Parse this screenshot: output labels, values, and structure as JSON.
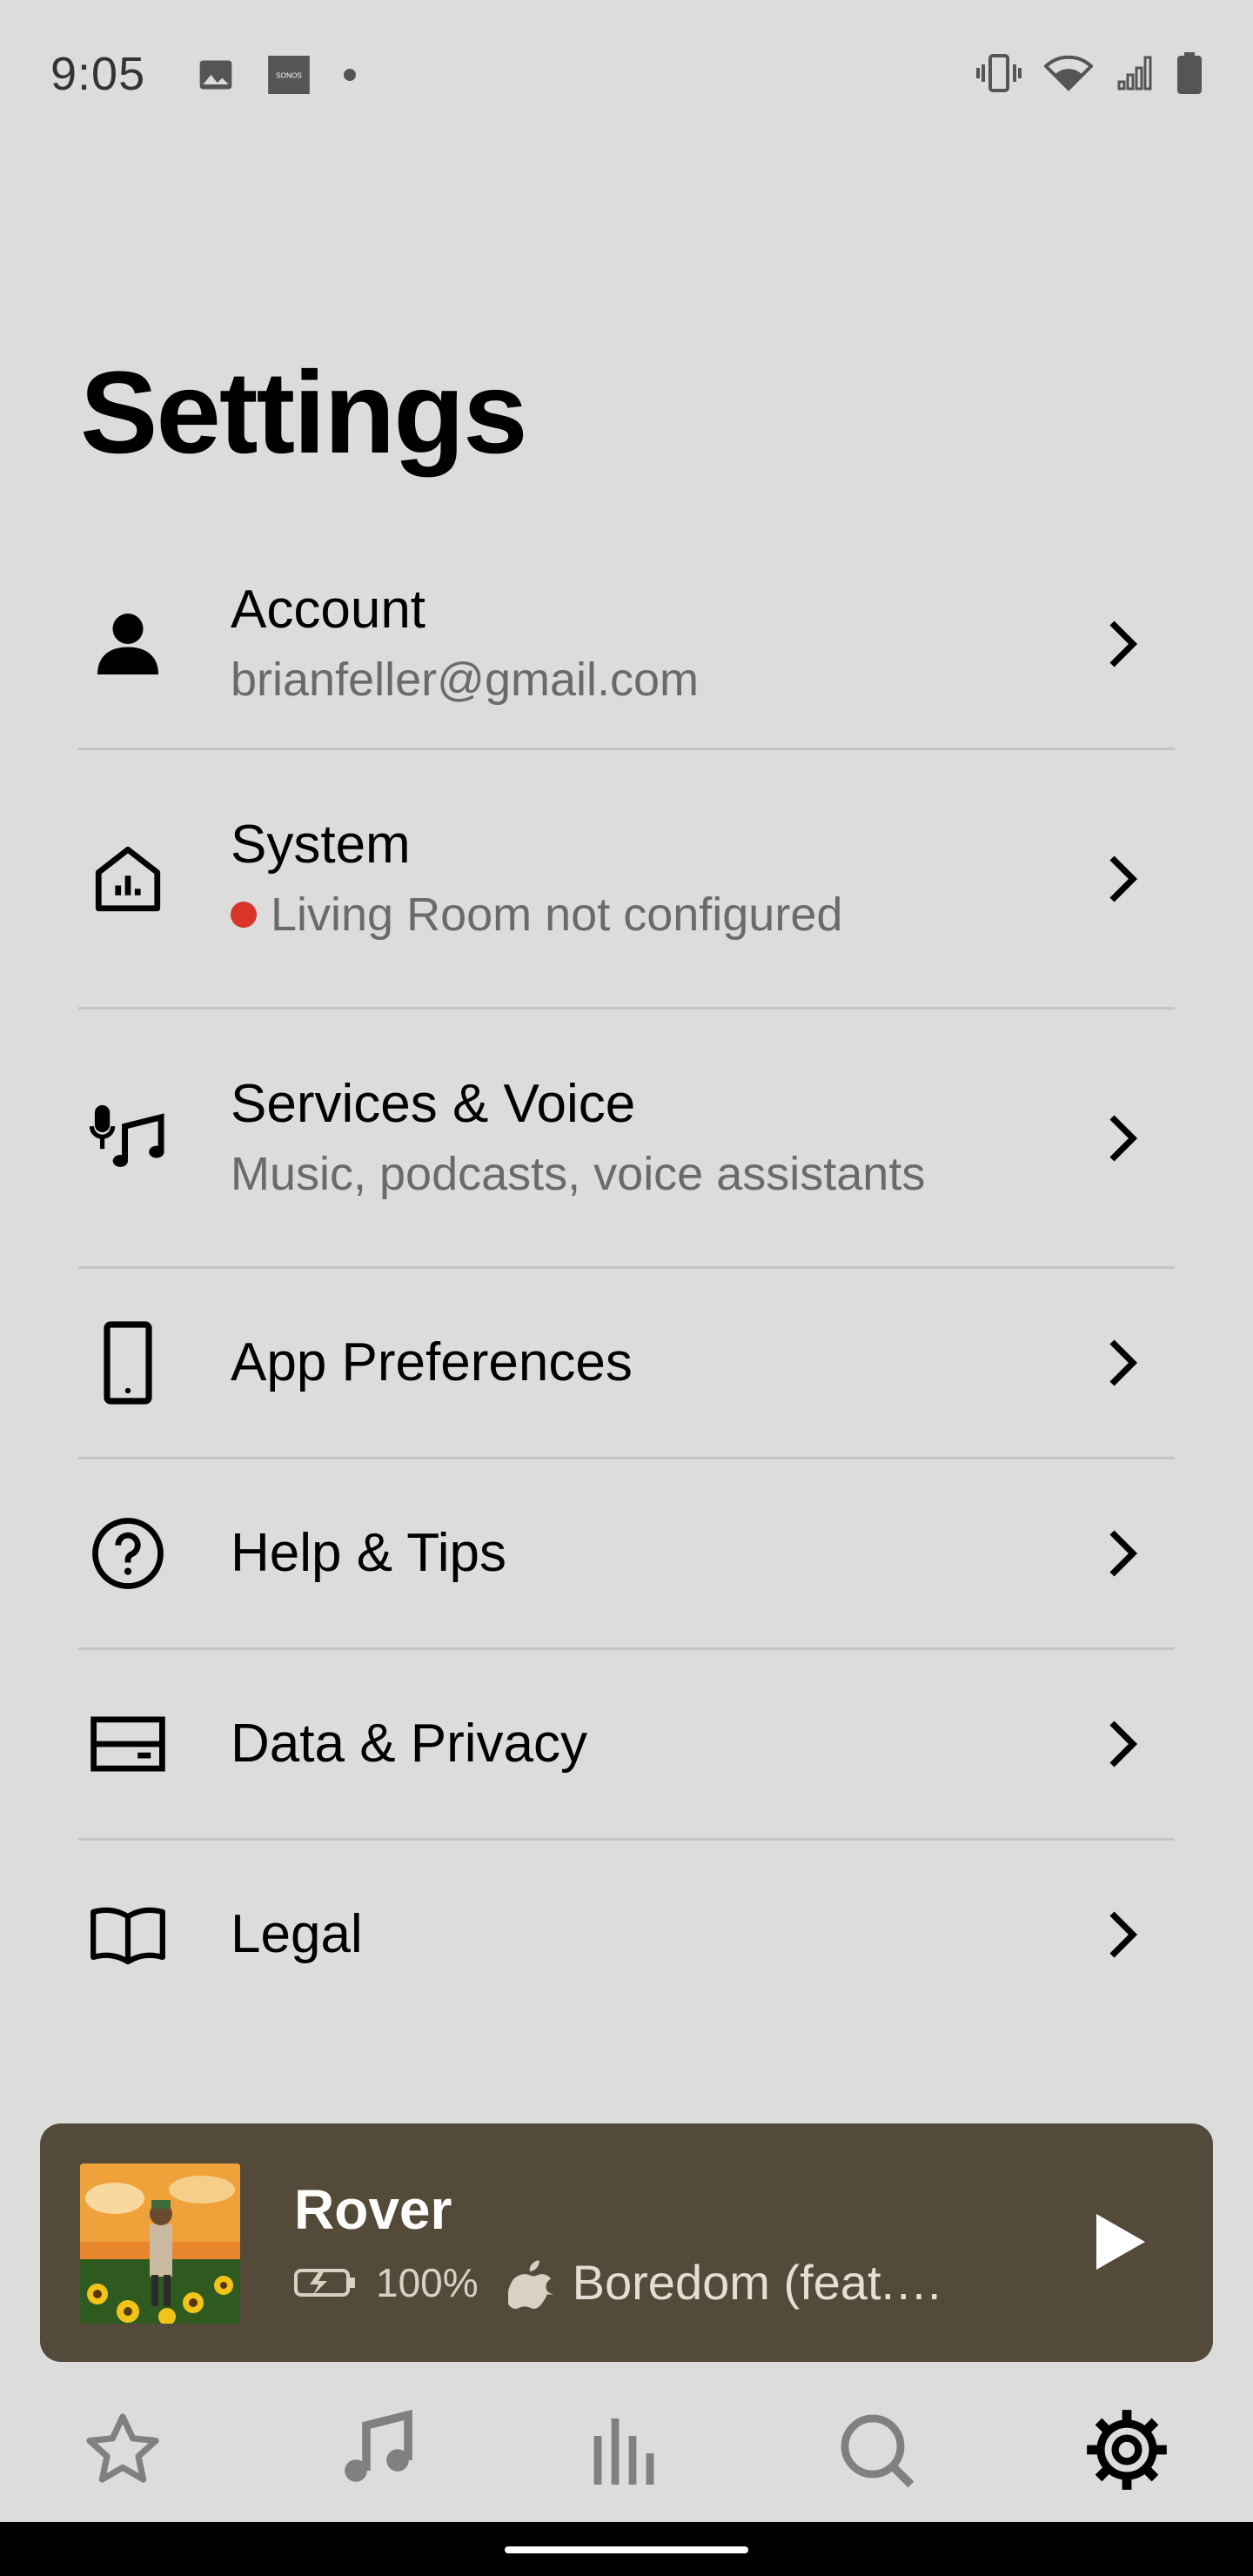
{
  "status_bar": {
    "time": "9:05",
    "left_icons": [
      "image-icon",
      "sonos-icon",
      "dot-icon"
    ],
    "sonos_label": "SONOS",
    "right_icons": [
      "vibrate-icon",
      "wifi-icon",
      "signal-icon",
      "battery-icon"
    ]
  },
  "page": {
    "title": "Settings"
  },
  "settings": {
    "items": [
      {
        "id": "account",
        "icon": "person-icon",
        "title": "Account",
        "subtitle": "brianfeller@gmail.com"
      },
      {
        "id": "system",
        "icon": "home-icon",
        "title": "System",
        "subtitle": "Living Room not configured",
        "status_color": "#d9352b"
      },
      {
        "id": "services",
        "icon": "mic-music-icon",
        "title": "Services & Voice",
        "subtitle": "Music, podcasts, voice assistants"
      },
      {
        "id": "app-preferences",
        "icon": "phone-icon",
        "title": "App Preferences"
      },
      {
        "id": "help",
        "icon": "help-icon",
        "title": "Help & Tips"
      },
      {
        "id": "data-privacy",
        "icon": "card-icon",
        "title": "Data & Privacy"
      },
      {
        "id": "legal",
        "icon": "book-icon",
        "title": "Legal"
      }
    ]
  },
  "now_playing": {
    "room": "Rover",
    "battery_percent": "100%",
    "service_icon": "apple-icon",
    "track": "Boredom (feat.…",
    "background": "#544a3a"
  },
  "tab_bar": {
    "tabs": [
      {
        "id": "favorites",
        "icon": "star-icon",
        "active": false
      },
      {
        "id": "music",
        "icon": "music-note-icon",
        "active": false
      },
      {
        "id": "rooms",
        "icon": "bars-icon",
        "active": false
      },
      {
        "id": "search",
        "icon": "search-icon",
        "active": false
      },
      {
        "id": "settings",
        "icon": "gear-icon",
        "active": true
      }
    ]
  }
}
